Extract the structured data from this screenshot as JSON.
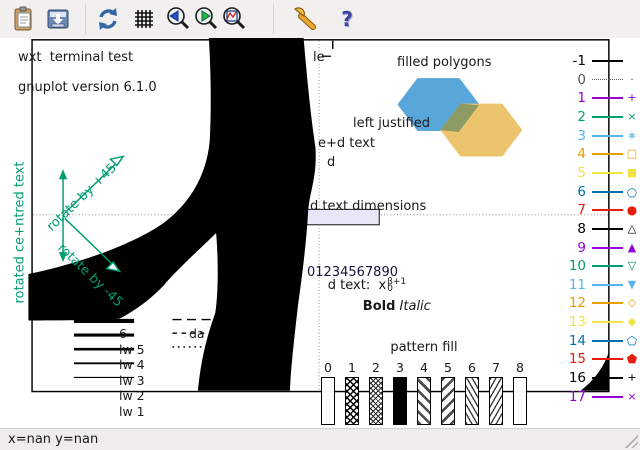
{
  "toolbar": {
    "icons": [
      {
        "name": "copy-clipboard"
      },
      {
        "name": "export-plot"
      },
      {
        "name": "refresh-plot"
      },
      {
        "name": "toggle-grid"
      },
      {
        "name": "zoom-previous"
      },
      {
        "name": "zoom-next"
      },
      {
        "name": "zoom-autoscale"
      },
      {
        "name": "settings-wrench"
      },
      {
        "name": "help",
        "glyph": "?"
      }
    ]
  },
  "statusbar": {
    "position_text": "x=nan y=nan"
  },
  "plot": {
    "terminal_title": "wxt  terminal test",
    "version": "gnuplot version 6.1.0",
    "filled_polygons_label": "filled polygons",
    "left_justified": "left justified",
    "centred_fragment": "e+d text",
    "right_justified_fragment": "d",
    "ticscale_fragment": "le",
    "text_dimensions_fragment": "d text dimensions",
    "char_width_digits": "01234567890",
    "enhanced_fragment": "d text:",
    "enhanced_base": "x",
    "enhanced_sub": "0",
    "enhanced_sup": "β+1",
    "bold_label": "Bold",
    "italic_label": "Italic",
    "rotated_centred_text": "rotated ce+ntred text",
    "rotate_plus_label": "rotate by +45",
    "rotate_minus_label": "rotate by -45",
    "dashtype_fragment": "da",
    "linewidth_rows": [
      {
        "label": "6",
        "weight": 5
      },
      {
        "label": "lw 5",
        "weight": 4.5
      },
      {
        "label": "lw 4",
        "weight": 3.5
      },
      {
        "label": "lw 3",
        "weight": 3
      },
      {
        "label": "lw 2",
        "weight": 2
      },
      {
        "label": "lw 1",
        "weight": 1
      }
    ],
    "pattern_fill": {
      "label": "pattern fill",
      "bars": [
        {
          "n": "0",
          "pattern": "empty"
        },
        {
          "n": "1",
          "pattern": "crosshatch"
        },
        {
          "n": "2",
          "pattern": "crosshatch-fine"
        },
        {
          "n": "3",
          "pattern": "solid"
        },
        {
          "n": "4",
          "pattern": "diag-down"
        },
        {
          "n": "5",
          "pattern": "diag-up"
        },
        {
          "n": "6",
          "pattern": "diag-down-fine"
        },
        {
          "n": "7",
          "pattern": "diag-up-fine"
        },
        {
          "n": "8",
          "pattern": "empty"
        }
      ]
    },
    "linetypes": [
      {
        "label": "-1",
        "color": "#000000",
        "symbol": "",
        "line": "solid"
      },
      {
        "label": "0",
        "color": "#555555",
        "symbol": "·",
        "line": "dotted"
      },
      {
        "label": "1",
        "color": "#9400d3",
        "symbol": "+",
        "line": "solid"
      },
      {
        "label": "2",
        "color": "#009e73",
        "symbol": "×",
        "line": "solid"
      },
      {
        "label": "3",
        "color": "#56b4e9",
        "symbol": "∗",
        "line": "solid"
      },
      {
        "label": "4",
        "color": "#e69f00",
        "symbol": "□",
        "line": "solid"
      },
      {
        "label": "5",
        "color": "#f0e442",
        "symbol": "■",
        "line": "solid"
      },
      {
        "label": "6",
        "color": "#0072b2",
        "symbol": "○",
        "line": "solid"
      },
      {
        "label": "7",
        "color": "#e51e10",
        "symbol": "●",
        "line": "solid"
      },
      {
        "label": "8",
        "color": "#000000",
        "symbol": "△",
        "line": "solid"
      },
      {
        "label": "9",
        "color": "#9400d3",
        "symbol": "▲",
        "line": "solid"
      },
      {
        "label": "10",
        "color": "#009e73",
        "symbol": "▽",
        "line": "solid"
      },
      {
        "label": "11",
        "color": "#56b4e9",
        "symbol": "▼",
        "line": "solid"
      },
      {
        "label": "12",
        "color": "#e69f00",
        "symbol": "◇",
        "line": "solid"
      },
      {
        "label": "13",
        "color": "#f0e442",
        "symbol": "◆",
        "line": "solid"
      },
      {
        "label": "14",
        "color": "#0072b2",
        "symbol": "⬠",
        "line": "solid"
      },
      {
        "label": "15",
        "color": "#e51e10",
        "symbol": "⬟",
        "line": "solid"
      },
      {
        "label": "16",
        "color": "#000000",
        "symbol": "+",
        "line": "solid"
      },
      {
        "label": "17",
        "color": "#9400d3",
        "symbol": "×",
        "line": "solid"
      }
    ],
    "colors": {
      "accent_green": "#009e73",
      "hex_blue": "#58a6da",
      "hex_yellow": "#ecc46d",
      "hex_overlap": "#8c9a64",
      "blob_black": "#000000",
      "digit_box_fill": "#e7e7f6"
    }
  }
}
